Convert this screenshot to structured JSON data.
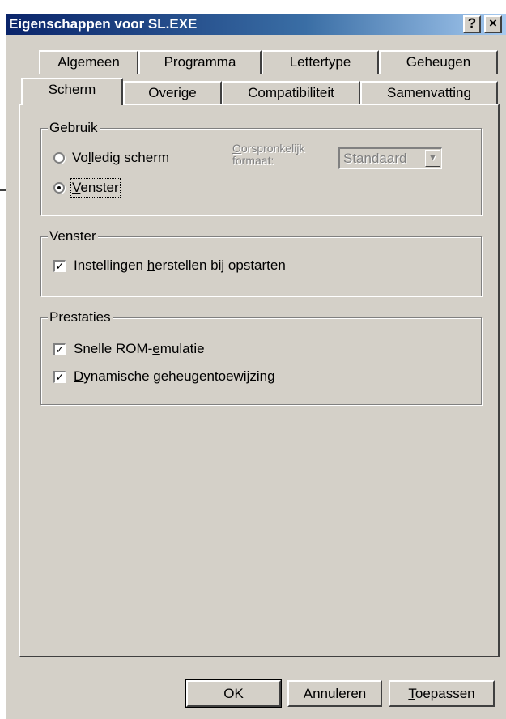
{
  "window": {
    "title": "Eigenschappen voor SL.EXE",
    "help_label": "?",
    "close_label": "×"
  },
  "tabs": {
    "back_row": [
      "Algemeen",
      "Programma",
      "Lettertype",
      "Geheugen"
    ],
    "front_row": [
      "Scherm",
      "Overige",
      "Compatibiliteit",
      "Samenvatting"
    ],
    "active": "Scherm"
  },
  "groups": {
    "gebruik": {
      "legend": "Gebruik",
      "fullscreen": {
        "pre": "Vo",
        "key": "l",
        "post": "ledig scherm",
        "checked": false
      },
      "window": {
        "pre": "",
        "key": "V",
        "post": "enster",
        "checked": true
      },
      "size_label_line1_key": "O",
      "size_label_line1": "orspronkelijk",
      "size_label_line2": "formaat:",
      "size_value": "Standaard"
    },
    "venster": {
      "legend": "Venster",
      "restore": {
        "pre": "Instellingen ",
        "key": "h",
        "post": "erstellen bij opstarten",
        "checked": true
      }
    },
    "prestaties": {
      "legend": "Prestaties",
      "rom": {
        "pre": "Snelle ROM-",
        "key": "e",
        "post": "mulatie",
        "checked": true
      },
      "memory": {
        "pre": "",
        "key": "D",
        "post": "ynamische geheugentoewijzing",
        "checked": true
      }
    }
  },
  "buttons": {
    "ok": "OK",
    "cancel": "Annuleren",
    "apply_key": "T",
    "apply_rest": "oepassen"
  },
  "icons": {
    "annotation_arrow": "arrow-right-icon",
    "check": "✓",
    "dropdown": "▼"
  }
}
